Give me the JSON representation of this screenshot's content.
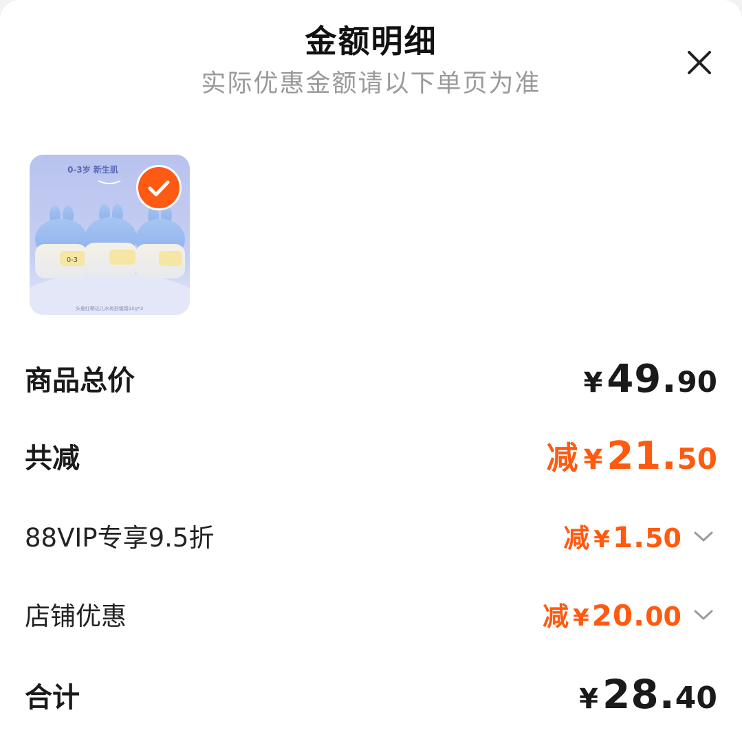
{
  "header": {
    "title": "金额明细",
    "subtitle": "实际优惠金额请以下单页为准"
  },
  "product": {
    "image_top_text": "0-3岁 新生肌",
    "image_bottom_text": "头悬红萌达儿水有舒缓霜10g*3",
    "jar_label": "0-3",
    "selected": true,
    "accent_color": "#ff5a14"
  },
  "rows": {
    "total": {
      "label": "商品总价",
      "currency": "¥",
      "integer": "49.",
      "decimal": "90"
    },
    "discount_total": {
      "label": "共减",
      "prefix": "减",
      "currency": "¥",
      "integer": "21.",
      "decimal": "50"
    },
    "vip": {
      "label": "88VIP专享9.5折",
      "prefix": "减",
      "currency": "¥",
      "integer": "1.",
      "decimal": "50",
      "icon": "chevron-down-icon"
    },
    "store": {
      "label": "店铺优惠",
      "prefix": "减",
      "currency": "¥",
      "integer": "20.",
      "decimal": "00",
      "icon": "chevron-down-icon"
    },
    "sum": {
      "label": "合计",
      "currency": "¥",
      "integer": "28.",
      "decimal": "40"
    }
  },
  "colors": {
    "discount": "#ff5a0f",
    "subtitle": "#9a9a9a",
    "text": "#1a1a1a"
  }
}
